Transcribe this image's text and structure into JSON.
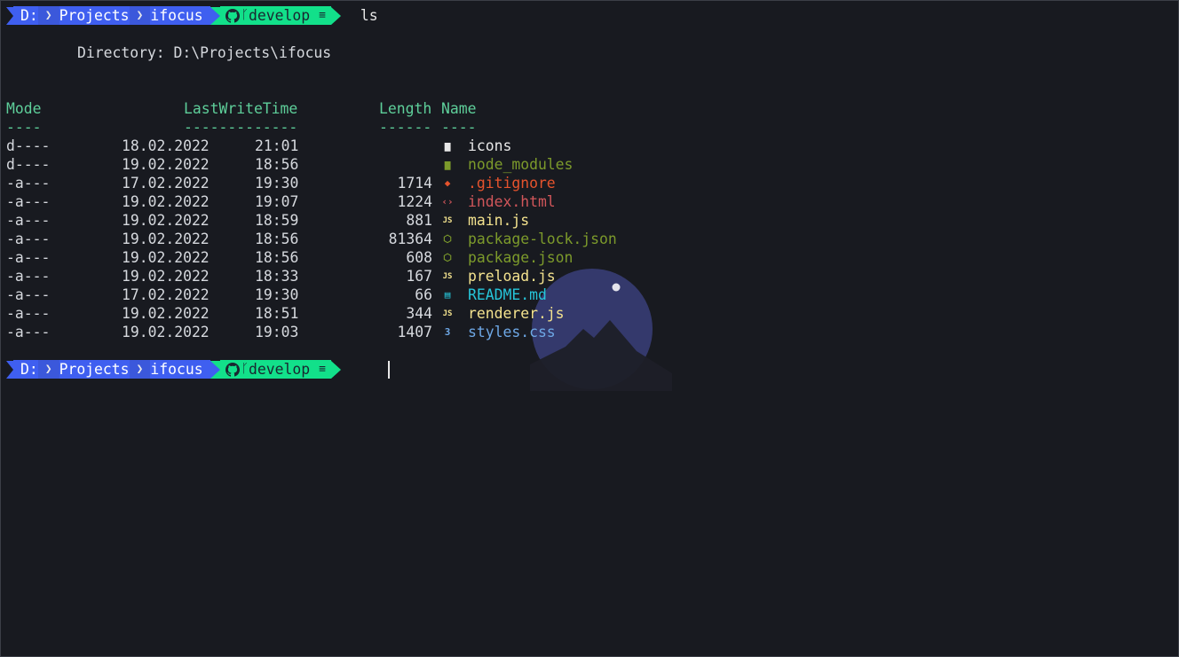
{
  "prompt": {
    "drive": "D:",
    "folder1": "Projects",
    "folder2": "ifocus",
    "branch": "develop",
    "status_glyph": "≡",
    "icons": [
      "github-icon",
      "branch-icon",
      "chevron-separator-icon"
    ]
  },
  "command": "ls",
  "directory_line": "Directory: D:\\Projects\\ifocus",
  "columns": {
    "mode": "Mode",
    "mode_rule": "----",
    "lwt": "LastWriteTime",
    "lwt_rule": "-------------",
    "length": "Length",
    "length_rule": "------",
    "name": "Name",
    "name_rule": "----"
  },
  "rows": [
    {
      "mode": "d----",
      "date": "18.02.2022",
      "time": "21:01",
      "length": "",
      "name": "icons",
      "icon": "folder-icon",
      "color": "#e8e8e8"
    },
    {
      "mode": "d----",
      "date": "19.02.2022",
      "time": "18:56",
      "length": "",
      "name": "node_modules",
      "icon": "folder-node-icon",
      "color": "#7c9a2b"
    },
    {
      "mode": "-a---",
      "date": "17.02.2022",
      "time": "19:30",
      "length": "1714",
      "name": ".gitignore",
      "icon": "git-icon",
      "color": "#e5532d"
    },
    {
      "mode": "-a---",
      "date": "19.02.2022",
      "time": "19:07",
      "length": "1224",
      "name": "index.html",
      "icon": "html-icon",
      "color": "#d1565a"
    },
    {
      "mode": "-a---",
      "date": "19.02.2022",
      "time": "18:59",
      "length": "881",
      "name": "main.js",
      "icon": "js-icon",
      "color": "#f3e28e"
    },
    {
      "mode": "-a---",
      "date": "19.02.2022",
      "time": "18:56",
      "length": "81364",
      "name": "package-lock.json",
      "icon": "nodejs-icon",
      "color": "#7c9a2b"
    },
    {
      "mode": "-a---",
      "date": "19.02.2022",
      "time": "18:56",
      "length": "608",
      "name": "package.json",
      "icon": "nodejs-icon",
      "color": "#7c9a2b"
    },
    {
      "mode": "-a---",
      "date": "19.02.2022",
      "time": "18:33",
      "length": "167",
      "name": "preload.js",
      "icon": "js-icon",
      "color": "#f3e28e"
    },
    {
      "mode": "-a---",
      "date": "17.02.2022",
      "time": "19:30",
      "length": "66",
      "name": "README.md",
      "icon": "book-icon",
      "color": "#26c6da"
    },
    {
      "mode": "-a---",
      "date": "19.02.2022",
      "time": "18:51",
      "length": "344",
      "name": "renderer.js",
      "icon": "js-icon",
      "color": "#f3e28e"
    },
    {
      "mode": "-a---",
      "date": "19.02.2022",
      "time": "19:03",
      "length": "1407",
      "name": "styles.css",
      "icon": "css-icon",
      "color": "#6ea8e6"
    }
  ],
  "colors": {
    "background": "#181a20",
    "prompt_blue": "#3f5ff0",
    "prompt_green": "#12e08a",
    "header_green": "#5ecf9a",
    "moon": "#3a3f7a"
  }
}
